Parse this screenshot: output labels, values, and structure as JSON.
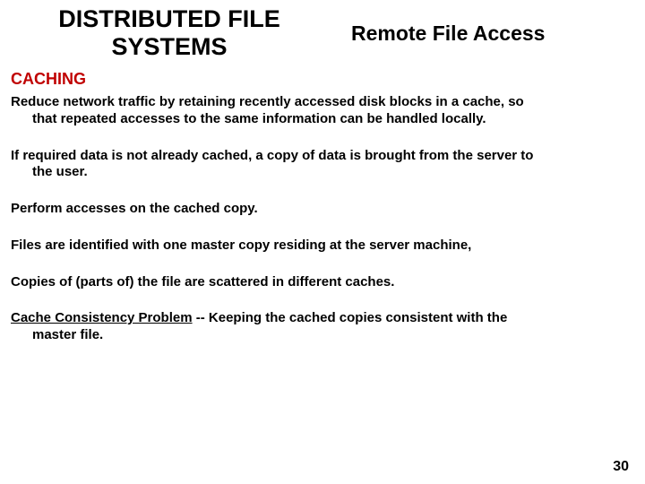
{
  "header": {
    "title_line1": "DISTRIBUTED FILE",
    "title_line2": "SYSTEMS",
    "subtitle": "Remote File Access"
  },
  "section": "CACHING",
  "paragraphs": {
    "p1a": "Reduce network traffic by retaining recently accessed disk blocks in a cache, so",
    "p1b": "that repeated accesses to the same information can be handled locally.",
    "p2a": "If required data is not already cached, a copy of data is brought from the server to",
    "p2b": "the user.",
    "p3": "Perform accesses on the cached copy.",
    "p4": "Files are identified with one master copy residing at the server machine,",
    "p5": "Copies of (parts of) the file are scattered in different caches.",
    "p6_strong": "Cache Consistency Problem",
    "p6a_rest": " -- Keeping the cached copies consistent with the",
    "p6b": "master file."
  },
  "page_number": "30"
}
